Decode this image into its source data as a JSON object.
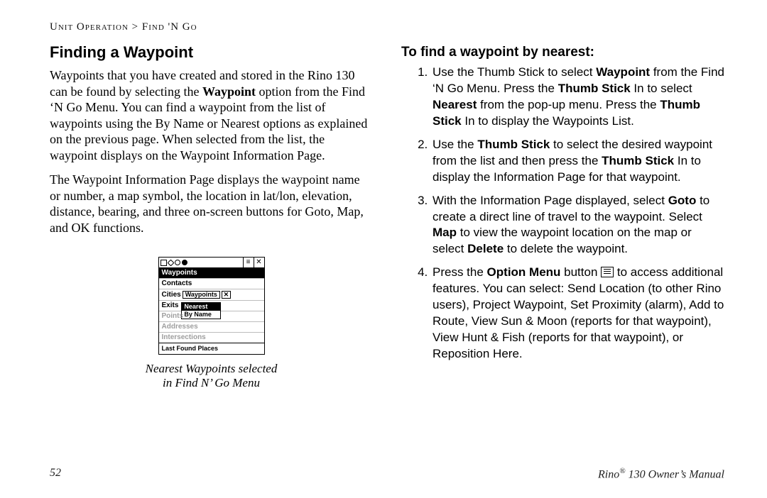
{
  "breadcrumb": "Unit Operation > Find 'N Go",
  "left": {
    "heading": "Finding a Waypoint",
    "para1_pre": "Waypoints that you have created and stored in the Rino 130 can be found by selecting the ",
    "para1_b1": "Waypoint",
    "para1_post": " option from the Find ‘N Go Menu. You can find a waypoint from the list of waypoints using the By Name or Nearest options as explained on the previous page. When selected from the list, the waypoint displays on the Waypoint Information Page.",
    "para2": "The Waypoint Information Page displays the waypoint name or number, a map symbol, the location in lat/lon, elevation, distance, bearing, and three on-screen buttons for Goto, Map, and OK functions.",
    "caption_l1": "Nearest Waypoints selected",
    "caption_l2": "in Find N’ Go Menu"
  },
  "right": {
    "subheading": "To find a waypoint by nearest:",
    "steps": [
      {
        "segments": [
          {
            "t": "Use the Thumb Stick to select "
          },
          {
            "t": "Waypoint",
            "b": true
          },
          {
            "t": " from the Find ‘N Go Menu. Press the "
          },
          {
            "t": "Thumb Stick",
            "b": true
          },
          {
            "t": " In to select "
          },
          {
            "t": "Nearest",
            "b": true
          },
          {
            "t": " from the pop-up menu. Press the "
          },
          {
            "t": "Thumb Stick",
            "b": true
          },
          {
            "t": " In to display the Waypoints List."
          }
        ]
      },
      {
        "segments": [
          {
            "t": "Use the "
          },
          {
            "t": "Thumb Stick",
            "b": true
          },
          {
            "t": " to select the desired waypoint from the list and then press the "
          },
          {
            "t": "Thumb Stick",
            "b": true
          },
          {
            "t": " In to display the Information Page for that waypoint."
          }
        ]
      },
      {
        "segments": [
          {
            "t": "With the Information Page displayed, select "
          },
          {
            "t": "Goto",
            "b": true
          },
          {
            "t": " to create a direct line of travel to the waypoint. Select "
          },
          {
            "t": "Map",
            "b": true
          },
          {
            "t": " to view the waypoint location on the map or select "
          },
          {
            "t": "Delete",
            "b": true
          },
          {
            "t": " to delete the waypoint."
          }
        ]
      },
      {
        "segments": [
          {
            "t": "Press the "
          },
          {
            "t": "Option Menu",
            "b": true
          },
          {
            "t": " button "
          },
          {
            "icon": "option-menu"
          },
          {
            "t": " to access additional features. You can select: Send Location (to other Rino users), Project Waypoint, Set Proximity (alarm), Add to Route, View Sun & Moon (reports for that waypoint), View Hunt & Fish (reports for that waypoint), or Reposition Here."
          }
        ]
      }
    ]
  },
  "device": {
    "tab": "Waypoints",
    "items": [
      "Contacts",
      "Cities",
      "Exits",
      "Points",
      "Addresses",
      "Intersections"
    ],
    "row_tag": "Waypoints",
    "popup": {
      "selected": "Nearest",
      "other": "By Name"
    },
    "last_found": "Last Found Places",
    "tb_close": "✕",
    "tb_menu": "≡"
  },
  "footer": {
    "page": "52",
    "manual_pre": "Rino",
    "manual_post": " 130 Owner’s Manual"
  }
}
